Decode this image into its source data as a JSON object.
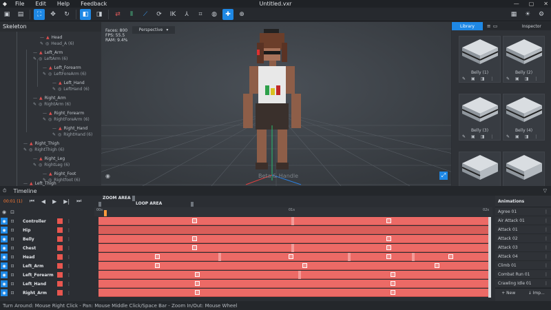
{
  "menubar": {
    "items": [
      "File",
      "Edit",
      "Help",
      "Feedback"
    ],
    "title": "Untitled.vxr"
  },
  "skeleton": {
    "title": "Skeleton",
    "nodes": [
      {
        "bone": "Head",
        "sub": "Head_A (6)"
      },
      {
        "bone": "Left_Arm",
        "sub": "LeftArm (6)"
      },
      {
        "bone": "Left_Forearm",
        "sub": "LeftForeArm (6)"
      },
      {
        "bone": "Left_Hand",
        "sub": "LeftHand (6)"
      },
      {
        "bone": "Right_Arm",
        "sub": "RightArm (6)"
      },
      {
        "bone": "Right_Forearm",
        "sub": "RightForeArm (6)"
      },
      {
        "bone": "Right_Hand",
        "sub": "RightHand (6)"
      },
      {
        "bone": "Right_Thigh",
        "sub": "RightThigh (6)"
      },
      {
        "bone": "Right_Leg",
        "sub": "RightLeg (6)"
      },
      {
        "bone": "Right_Foot",
        "sub": "Rightfoot (6)"
      },
      {
        "bone": "Left_Thigh",
        "sub": ""
      }
    ]
  },
  "viewport": {
    "stats": {
      "faces": "Faces: 800",
      "fps": "FPS: 55.5",
      "ram": "RAM: 9.4%"
    },
    "projection": "Perspective",
    "watermark": "Beta & Handle"
  },
  "library": {
    "tabs": [
      "Library",
      "Inspector"
    ],
    "tiles": [
      "Belly (1)",
      "Belly (2)",
      "Belly (3)",
      "Belly (4)",
      "",
      ""
    ]
  },
  "timeline": {
    "title": "Timeline",
    "current_time": "00:01 (1)",
    "zoom_label": "ZOOM AREA",
    "loop_label": "LOOP AREA",
    "ruler_labels": [
      "00s",
      "01s",
      "02s"
    ],
    "tracks": [
      "Controller",
      "Hip",
      "Belly",
      "Chest",
      "Head",
      "Left_Arm",
      "Left_Forearm",
      "Left_Hand",
      "Right_Arm"
    ]
  },
  "animations": {
    "title": "Animations",
    "items": [
      "Agree 01",
      "Air Attack 01",
      "Attack 01",
      "Attack 02",
      "Attack 03",
      "Attack 04",
      "Climb 01",
      "Combat Run 01",
      "Crawling Idle 01"
    ],
    "new_label": "+ New",
    "import_label": "↓ Imp..."
  },
  "statusbar": {
    "text": "Turn Around: Mouse Right Click - Pan: Mouse Middle Click/Space Bar - Zoom In/Out: Mouse Wheel"
  },
  "colors": {
    "accent": "#1e88e5",
    "track": "#ec6a66",
    "time": "#ff7a33"
  }
}
